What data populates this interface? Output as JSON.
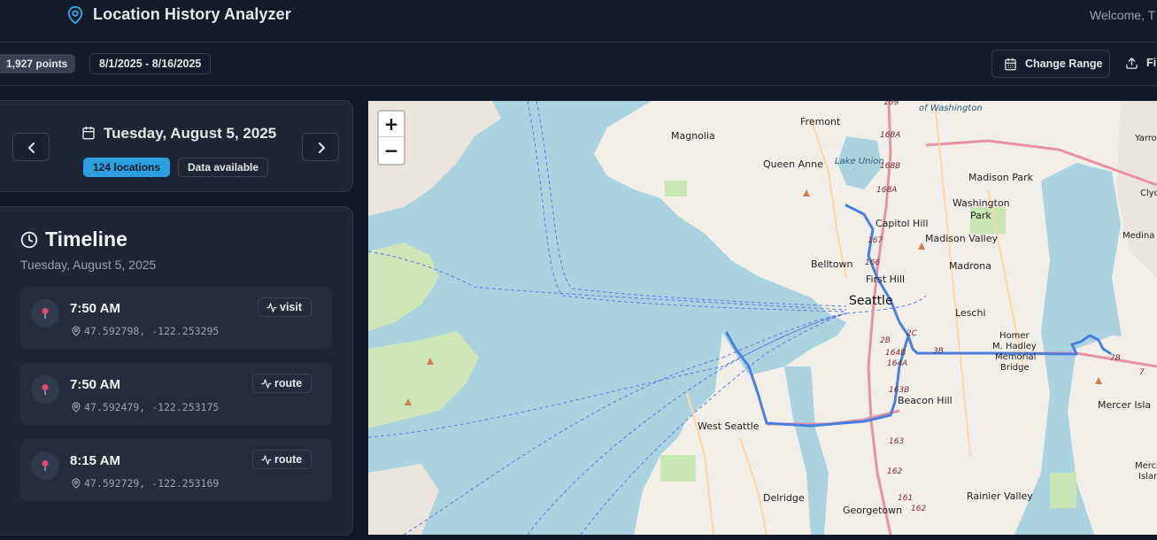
{
  "header": {
    "title": "Location History Analyzer",
    "welcome": "Welcome, T"
  },
  "toolbar": {
    "points_badge": "1,927 points",
    "date_range": "8/1/2025 - 8/16/2025",
    "change_range_label": "Change Range",
    "file_label": "Fil"
  },
  "day_nav": {
    "date": "Tuesday, August 5, 2025",
    "locations_badge": "124 locations",
    "data_badge": "Data available"
  },
  "timeline": {
    "title": "Timeline",
    "subtitle": "Tuesday, August 5, 2025",
    "entries": [
      {
        "time": "7:50 AM",
        "coords": "47.592798, -122.253295",
        "type": "visit"
      },
      {
        "time": "7:50 AM",
        "coords": "47.592479, -122.253175",
        "type": "route"
      },
      {
        "time": "8:15 AM",
        "coords": "47.592729, -122.253169",
        "type": "route"
      }
    ]
  },
  "map": {
    "zoom_in": "+",
    "zoom_out": "−",
    "labels": {
      "fremont": "Fremont",
      "magnolia": "Magnolia",
      "queen_anne": "Queen Anne",
      "lake_union": "Lake Union",
      "madison_park": "Madison Park",
      "washington_park_1": "Washington",
      "washington_park_2": "Park",
      "capitol_hill": "Capitol Hill",
      "madison_valley": "Madison Valley",
      "belltown": "Belltown",
      "madrona": "Madrona",
      "first_hill": "First Hill",
      "seattle": "Seattle",
      "leschi": "Leschi",
      "homer_1": "Homer",
      "homer_2": "M. Hadley",
      "homer_3": "Memorial",
      "homer_4": "Bridge",
      "beacon_hill": "Beacon Hill",
      "west_seattle": "West Seattle",
      "mercer_island": "Mercer Isla",
      "delridge": "Delridge",
      "rainier_valley": "Rainier Valley",
      "georgetown": "Georgetown",
      "medina": "Medina",
      "yarrow": "Yarro",
      "clyde": "Clyd",
      "uw": "of Washington",
      "mercer_island_2": "Mercer",
      "mercer_island_3": "Islan",
      "r169": "169",
      "r168a": "168A",
      "r168b": "168B",
      "r168a2": "168A",
      "r167": "167",
      "r166": "166",
      "r165": "165",
      "r2b": "2B",
      "r164b": "164B",
      "r164a": "164A",
      "r2c": "2C",
      "r3b": "3B",
      "r7b": "7B",
      "r163b": "163B",
      "r163": "163",
      "r162": "162",
      "r161": "161",
      "r162b": "162",
      "r7": "7"
    }
  },
  "colors": {
    "accent": "#2b9fe0",
    "route": "#4a7fe0",
    "water": "#aad3df",
    "land": "#f2efe9"
  }
}
